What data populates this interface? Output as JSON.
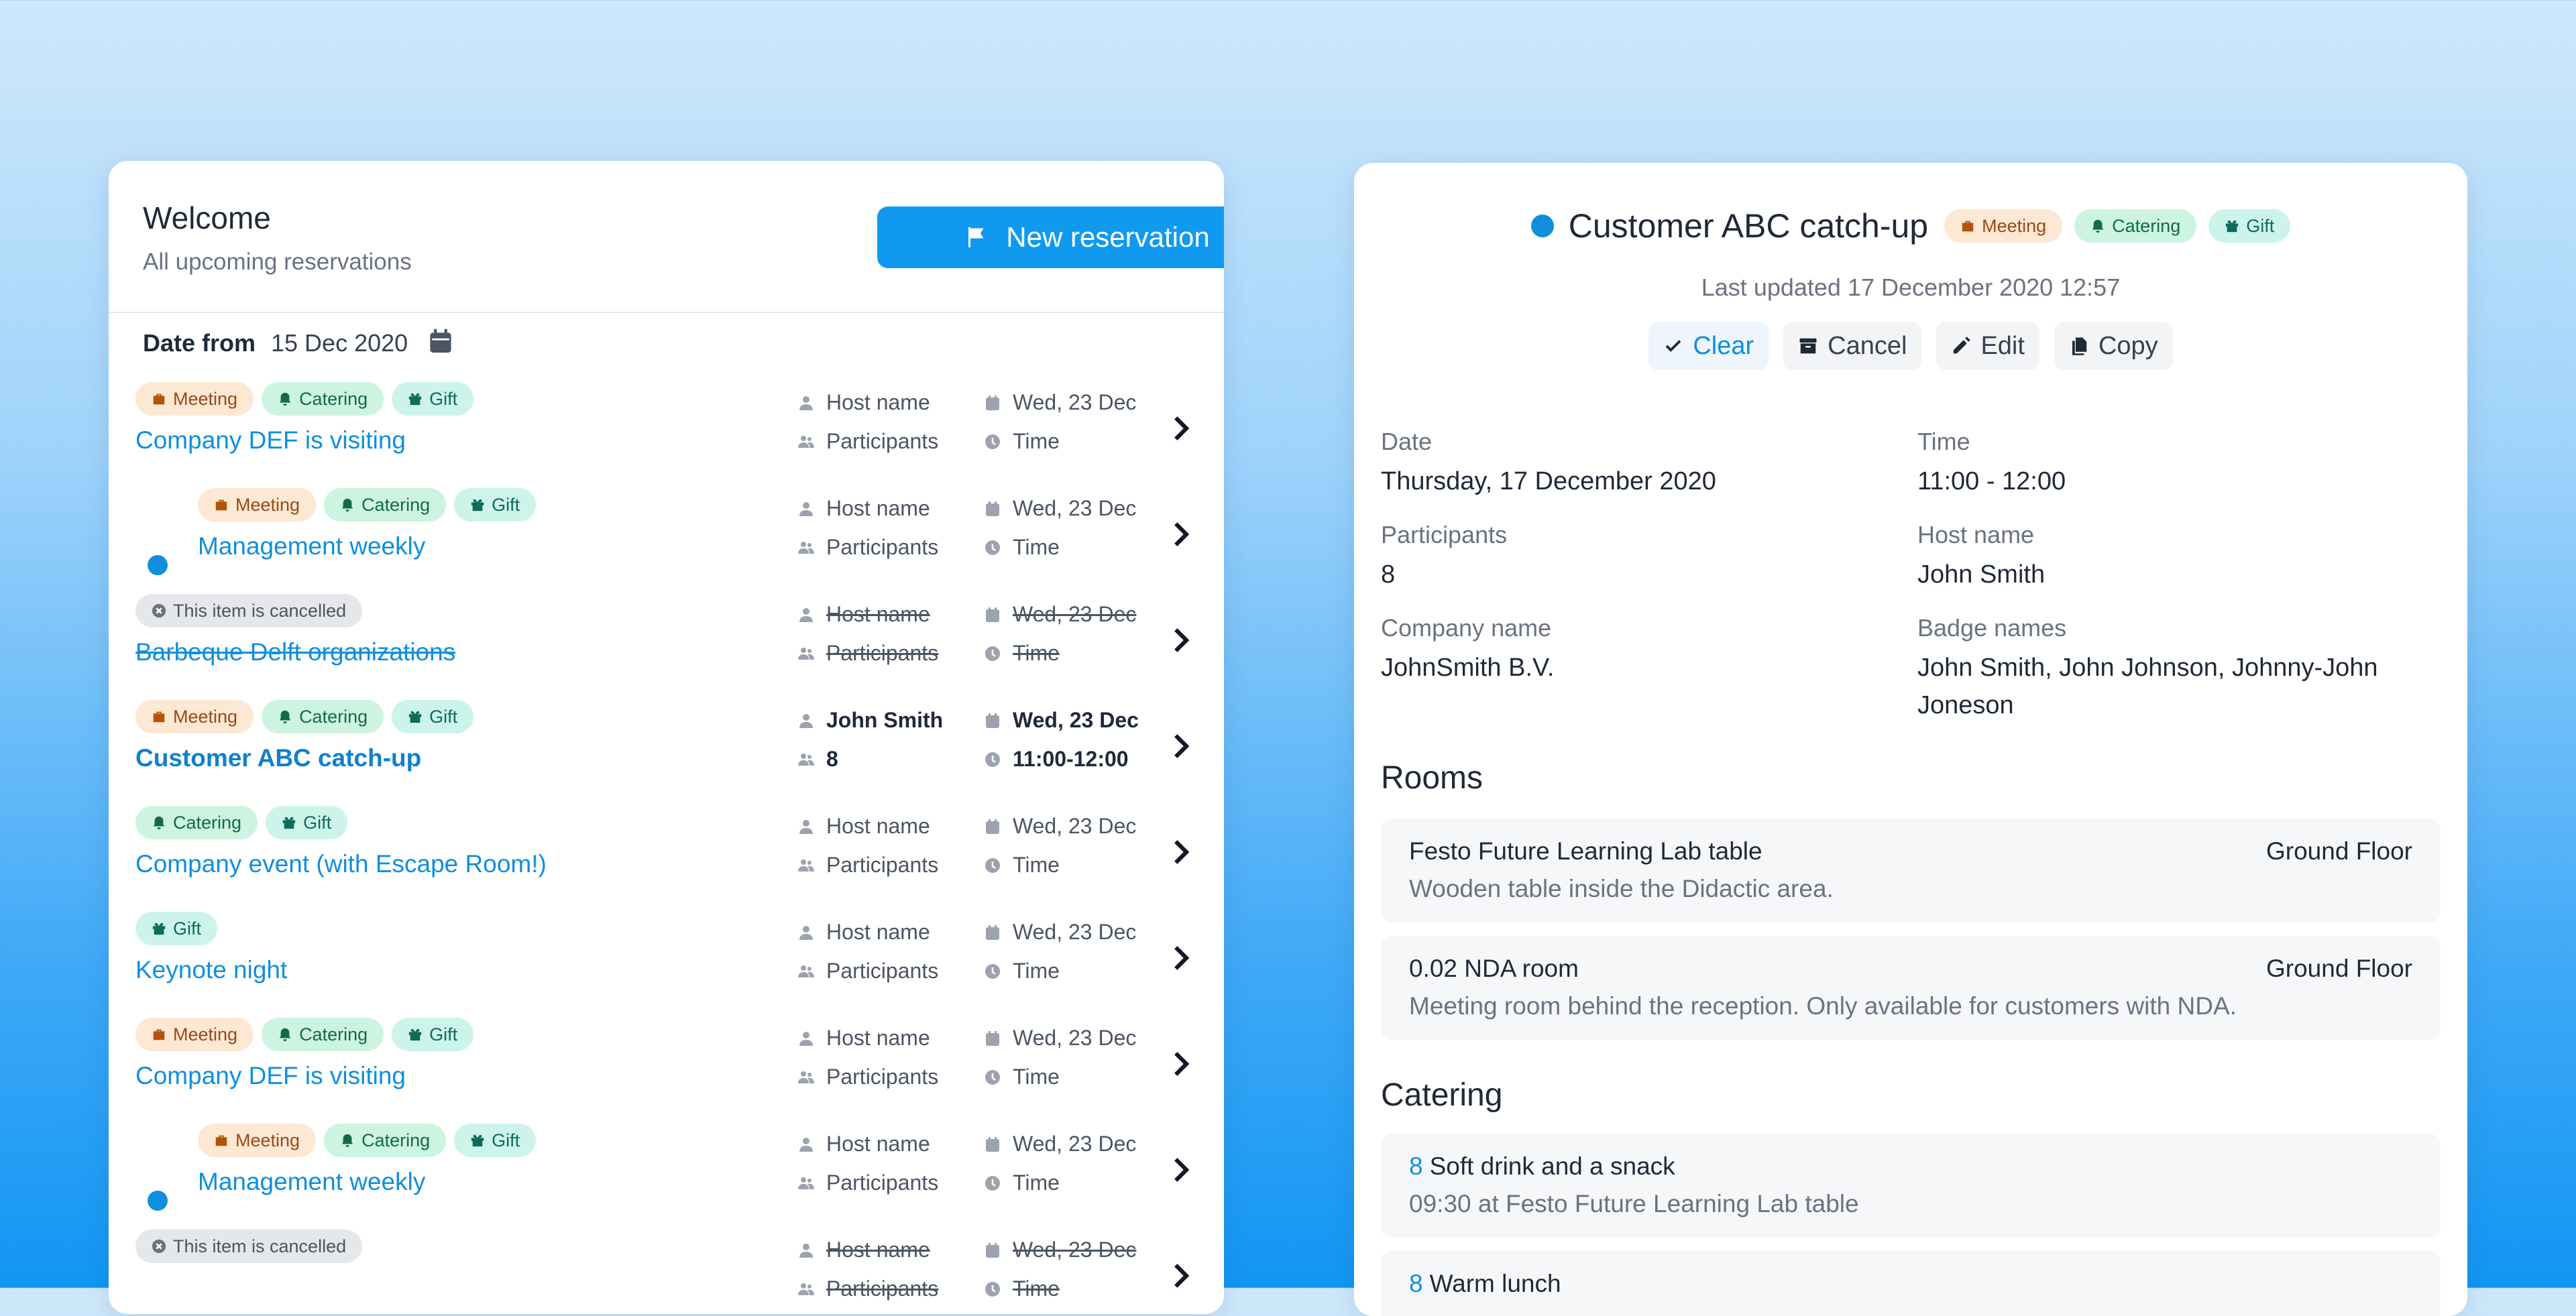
{
  "left": {
    "title": "Welcome",
    "subtitle": "All upcoming reservations",
    "new_button": "New reservation",
    "date_from_label": "Date from",
    "date_from_value": "15 Dec 2020",
    "tag_labels": {
      "meeting": "Meeting",
      "catering": "Catering",
      "gift": "Gift",
      "cancelled": "This item is cancelled"
    },
    "rows": [
      {
        "title": "Company DEF is visiting",
        "host": "Host name",
        "participants": "Participants",
        "date": "Wed, 23 Dec",
        "time": "Time"
      },
      {
        "title": "Management weekly",
        "host": "Host name",
        "participants": "Participants",
        "date": "Wed, 23 Dec",
        "time": "Time"
      },
      {
        "title": "Barbeque Delft organizations",
        "host": "Host name",
        "participants": "Participants",
        "date": "Wed, 23 Dec",
        "time": "Time"
      },
      {
        "title": "Customer ABC catch-up",
        "host": "John Smith",
        "participants": "8",
        "date": "Wed, 23 Dec",
        "time": "11:00-12:00"
      },
      {
        "title": "Company event (with Escape Room!)",
        "host": "Host name",
        "participants": "Participants",
        "date": "Wed, 23 Dec",
        "time": "Time"
      },
      {
        "title": "Keynote night",
        "host": "Host name",
        "participants": "Participants",
        "date": "Wed, 23 Dec",
        "time": "Time"
      },
      {
        "title": "Company DEF is visiting",
        "host": "Host name",
        "participants": "Participants",
        "date": "Wed, 23 Dec",
        "time": "Time"
      },
      {
        "title": "Management weekly",
        "host": "Host name",
        "participants": "Participants",
        "date": "Wed, 23 Dec",
        "time": "Time"
      },
      {
        "title": "",
        "host": "Host name",
        "participants": "Participants",
        "date": "Wed, 23 Dec",
        "time": "Time"
      }
    ]
  },
  "right": {
    "title": "Customer ABC catch-up",
    "tags": {
      "meeting": "Meeting",
      "catering": "Catering",
      "gift": "Gift"
    },
    "last_updated": "Last updated 17 December 2020 12:57",
    "actions": {
      "clear": "Clear",
      "cancel": "Cancel",
      "edit": "Edit",
      "copy": "Copy"
    },
    "fields": {
      "date_label": "Date",
      "date_value": "Thursday, 17 December 2020",
      "time_label": "Time",
      "time_value": "11:00 - 12:00",
      "participants_label": "Participants",
      "participants_value": "8",
      "host_label": "Host name",
      "host_value": "John Smith",
      "company_label": "Company name",
      "company_value": "JohnSmith B.V.",
      "badge_label": "Badge names",
      "badge_value": "John Smith, John Johnson, Johnny-John Joneson"
    },
    "rooms_heading": "Rooms",
    "rooms": [
      {
        "name": "Festo Future Learning Lab table",
        "floor": "Ground Floor",
        "desc": "Wooden table inside the Didactic area."
      },
      {
        "name": "0.02 NDA room",
        "floor": "Ground Floor",
        "desc": "Meeting room behind the reception. Only available for customers with NDA."
      }
    ],
    "catering_heading": "Catering",
    "catering": [
      {
        "qty": "8",
        "item": "Soft drink and a snack",
        "detail": "09:30 at Festo Future Learning Lab table"
      },
      {
        "qty": "8",
        "item": "Warm lunch",
        "detail": ""
      }
    ]
  }
}
